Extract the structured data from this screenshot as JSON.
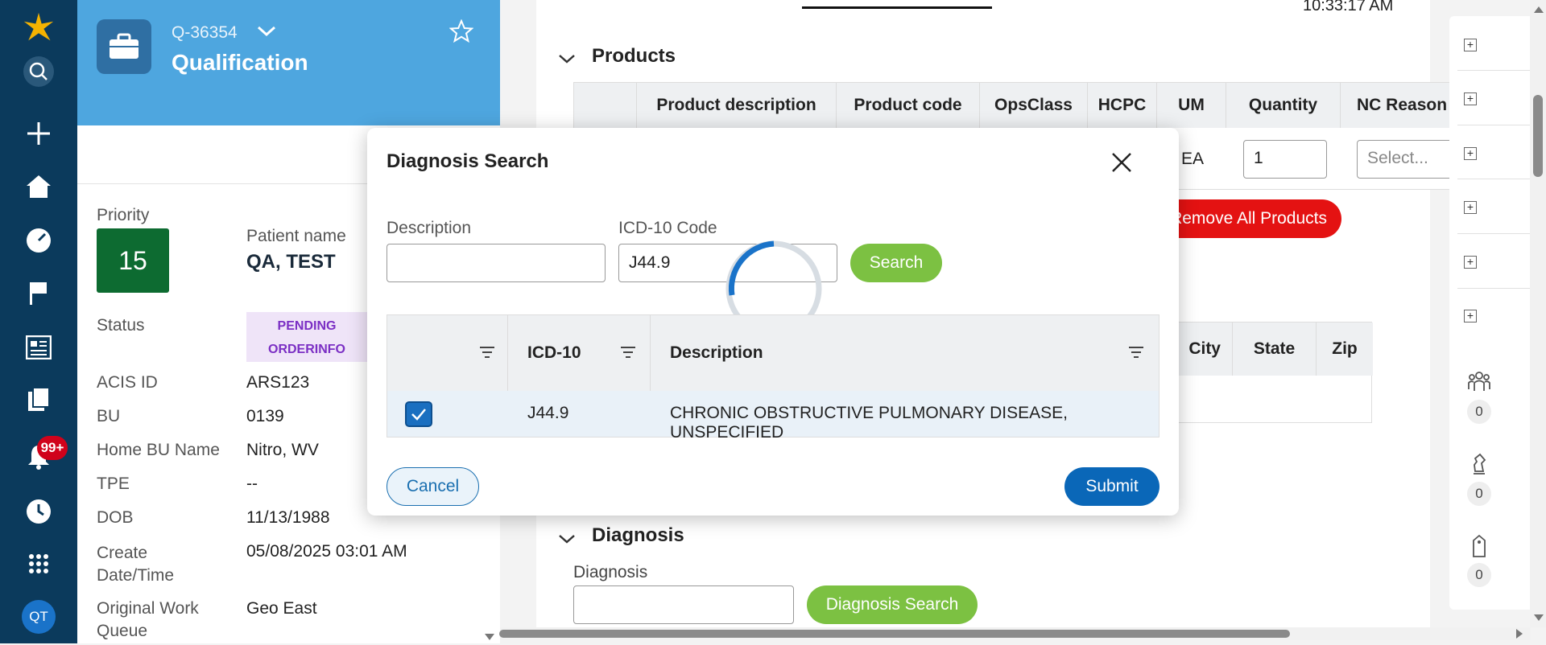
{
  "header": {
    "quote_id": "Q-36354",
    "stage": "Qualification"
  },
  "patient": {
    "priority_label": "Priority",
    "priority_value": "15",
    "name_label": "Patient name",
    "name_value": "QA, TEST",
    "status_label": "Status",
    "status_value": "PENDING ORDERINFO",
    "fields": [
      {
        "label": "ACIS ID",
        "value": "ARS123"
      },
      {
        "label": "BU",
        "value": "0139"
      },
      {
        "label": "Home BU Name",
        "value": "Nitro, WV"
      },
      {
        "label": "TPE",
        "value": "--"
      },
      {
        "label": "DOB",
        "value": "11/13/1988"
      },
      {
        "label": "Create Date/Time",
        "value": "05/08/2025 03:01 AM"
      },
      {
        "label": "Original Work Queue",
        "value": "Geo East"
      }
    ]
  },
  "main": {
    "time": "10:33:17 AM",
    "products_section": "Products",
    "products_columns": [
      "Product description",
      "Product code",
      "OpsClass",
      "HCPC",
      "UM",
      "Quantity",
      "NC Reason"
    ],
    "product_row": {
      "um": "EA",
      "quantity": "1",
      "nc_reason_placeholder": "Select..."
    },
    "remove_all_label": "Remove All Products",
    "address_columns": [
      "City",
      "State",
      "Zip"
    ],
    "diagnosis_section": "Diagnosis",
    "diagnosis_label": "Diagnosis",
    "diagnosis_search_label": "Diagnosis Search"
  },
  "right_panel": {
    "counts": [
      "0",
      "0",
      "0"
    ]
  },
  "nav": {
    "notification_badge": "99+",
    "avatar_initials": "QT"
  },
  "modal": {
    "title": "Diagnosis Search",
    "description_label": "Description",
    "description_value": "",
    "icd_label": "ICD-10 Code",
    "icd_value": "J44.9",
    "search_label": "Search",
    "columns": [
      "ICD-10",
      "Description"
    ],
    "rows": [
      {
        "selected": true,
        "icd": "J44.9",
        "description": "CHRONIC OBSTRUCTIVE PULMONARY DISEASE, UNSPECIFIED"
      }
    ],
    "cancel_label": "Cancel",
    "submit_label": "Submit"
  },
  "colors": {
    "nav": "#0b3a5c",
    "header": "#4ea6df",
    "green": "#7cc142",
    "primary": "#0a67b8",
    "red": "#e41212",
    "priority": "#0d6b31"
  }
}
